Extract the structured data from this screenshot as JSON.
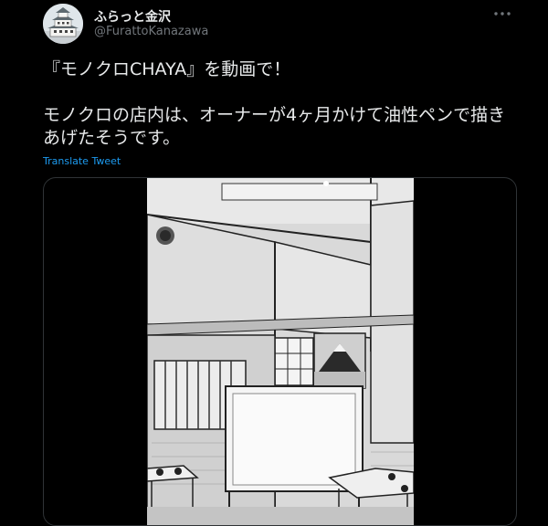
{
  "account": {
    "display_name": "ふらっと金沢",
    "handle": "@FurattoKanazawa",
    "avatar_icon": "castle-avatar"
  },
  "tweet": {
    "line1": "『モノクロCHAYA』を動画で！",
    "line2": "モノクロの店内は、オーナーが4ヶ月かけて油性ペンで描きあげたそうです。",
    "translate_label": "Translate Tweet"
  },
  "icons": {
    "more": "more-dots-icon"
  },
  "colors": {
    "background": "#000000",
    "text": "#e7e9ea",
    "secondary": "#71767b",
    "link": "#1d9bf0",
    "border": "#2f3336"
  }
}
